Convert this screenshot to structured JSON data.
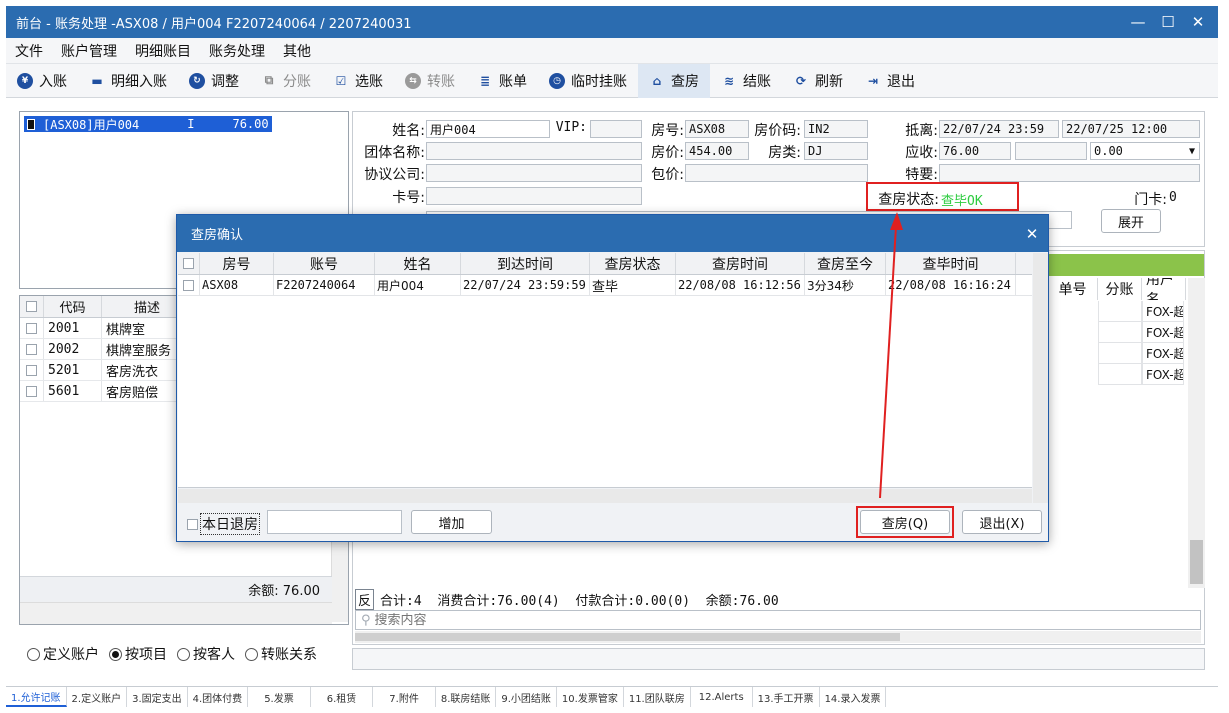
{
  "window": {
    "title": "前台 - 账务处理 -ASX08 / 用户004 F2207240064 / 2207240031",
    "minimize": "—",
    "maximize": "☐",
    "close": "✕"
  },
  "menu": [
    "文件",
    "账户管理",
    "明细账目",
    "账务处理",
    "其他"
  ],
  "toolbar": [
    {
      "label": "入账",
      "icon": "¥"
    },
    {
      "label": "明细入账",
      "icon": "▬"
    },
    {
      "label": "调整",
      "icon": "↻"
    },
    {
      "label": "分账",
      "icon": "⧉"
    },
    {
      "label": "选账",
      "icon": "☑"
    },
    {
      "label": "转账",
      "icon": "⇆"
    },
    {
      "label": "账单",
      "icon": "≣"
    },
    {
      "label": "临时挂账",
      "icon": "◷"
    },
    {
      "label": "查房",
      "icon": "⌂"
    },
    {
      "label": "结账",
      "icon": "≋"
    },
    {
      "label": "刷新",
      "icon": "⟳"
    },
    {
      "label": "退出",
      "icon": "⇥"
    }
  ],
  "account_list": {
    "selected_code": "[ASX08]用户004",
    "selected_flag": "I",
    "selected_amount": "76.00"
  },
  "item_table": {
    "headers": [
      "代码",
      "描述"
    ],
    "rows": [
      {
        "code": "2001",
        "desc": "棋牌室"
      },
      {
        "code": "2002",
        "desc": "棋牌室服务"
      },
      {
        "code": "5201",
        "desc": "客房洗衣"
      },
      {
        "code": "5601",
        "desc": "客房赔偿"
      }
    ],
    "balance": "余额: 76.00"
  },
  "radios": [
    {
      "label": "定义账户",
      "checked": false
    },
    {
      "label": "按项目",
      "checked": true
    },
    {
      "label": "按客人",
      "checked": false
    },
    {
      "label": "转账关系",
      "checked": false
    }
  ],
  "guest": {
    "name_label": "姓名:",
    "name_value": "用户004",
    "vip_label": "VIP:",
    "vip_value": "",
    "room_label": "房号:",
    "room_value": "ASX08",
    "rate_code_label": "房价码:",
    "rate_code_value": "IN2",
    "arrival_label": "抵离:",
    "arrival_value": "22/07/24 23:59",
    "departure_value": "22/07/25 12:00",
    "group_label": "团体名称:",
    "room_rate_label": "房价:",
    "room_rate_value": "454.00",
    "room_type_label": "房类:",
    "room_type_value": "DJ",
    "receivable_label": "应收:",
    "receivable_value": "76.00",
    "dropdown_value": "0.00",
    "agreement_label": "协议公司:",
    "package_label": "包价:",
    "special_label": "特要:",
    "card_label": "卡号:",
    "checkroom_status_label": "查房状态:",
    "checkroom_status_value": "查毕OK",
    "door_card_label": "门卡:",
    "door_card_value": "0",
    "expand_button": "展开"
  },
  "right_table": {
    "headers": [
      "单号",
      "分账",
      "用户名"
    ],
    "rows": [
      "FOX-超",
      "FOX-超",
      "FOX-超",
      "FOX-超"
    ],
    "summary_fan": "反",
    "summary_text": "合计:4  消费合计:76.00(4)  付款合计:0.00(0)  余额:76.00",
    "search_placeholder": "搜索内容"
  },
  "tabs": [
    "1.允许记账",
    "2.定义账户",
    "3.固定支出",
    "4.团体付费",
    "5.发票",
    "6.租赁",
    "7.附件",
    "8.联房结账",
    "9.小团结账",
    "10.发票管家",
    "11.团队联房",
    "12.Alerts",
    "13.手工开票",
    "14.录入发票"
  ],
  "dialog": {
    "title": "查房确认",
    "close": "✕",
    "headers": [
      "房号",
      "账号",
      "姓名",
      "到达时间",
      "查房状态",
      "查房时间",
      "查房至今",
      "查毕时间"
    ],
    "rows": [
      {
        "room": "ASX08",
        "account": "F2207240064",
        "name": "用户004",
        "arrival": "22/07/24 23:59:59",
        "status": "查毕",
        "check_time": "22/08/08 16:12:56",
        "elapsed": "3分34秒",
        "done_time": "22/08/08 16:16:24"
      }
    ],
    "today_checkout_label": "本日退房",
    "add_button": "增加",
    "confirm_button": "查房(Q)",
    "exit_button": "退出(X)"
  },
  "colors": {
    "title_bar": "#2b6cb0",
    "selection": "#1e5fd6",
    "status_ok": "#2ecc40",
    "green_bar": "#8bc34a",
    "highlight": "#e02020"
  }
}
